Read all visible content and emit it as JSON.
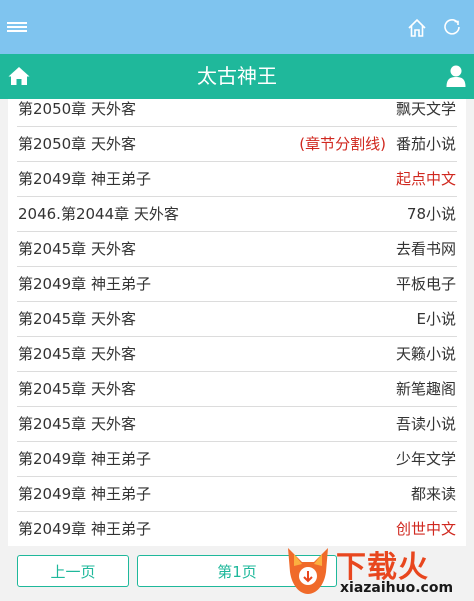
{
  "header": {
    "title": "太古神王"
  },
  "rows": [
    {
      "chapter": "第2050章 天外客",
      "source": "飘天文学",
      "highlight": false,
      "marker": ""
    },
    {
      "chapter": "第2050章 天外客",
      "source": "番茄小说",
      "highlight": false,
      "marker": "(章节分割线)"
    },
    {
      "chapter": "第2049章 神王弟子",
      "source": "起点中文",
      "highlight": true,
      "marker": ""
    },
    {
      "chapter": "2046.第2044章 天外客",
      "source": "78小说",
      "highlight": false,
      "marker": ""
    },
    {
      "chapter": "第2045章 天外客",
      "source": "去看书网",
      "highlight": false,
      "marker": ""
    },
    {
      "chapter": "第2049章 神王弟子",
      "source": "平板电子",
      "highlight": false,
      "marker": ""
    },
    {
      "chapter": "第2045章 天外客",
      "source": "E小说",
      "highlight": false,
      "marker": ""
    },
    {
      "chapter": "第2045章 天外客",
      "source": "天籁小说",
      "highlight": false,
      "marker": ""
    },
    {
      "chapter": "第2045章 天外客",
      "source": "新笔趣阁",
      "highlight": false,
      "marker": ""
    },
    {
      "chapter": "第2045章 天外客",
      "source": "吾读小说",
      "highlight": false,
      "marker": ""
    },
    {
      "chapter": "第2049章 神王弟子",
      "source": "少年文学",
      "highlight": false,
      "marker": ""
    },
    {
      "chapter": "第2049章 神王弟子",
      "source": "都来读",
      "highlight": false,
      "marker": ""
    },
    {
      "chapter": "第2049章 神王弟子",
      "source": "创世中文",
      "highlight": true,
      "marker": ""
    }
  ],
  "pager": {
    "prev_label": "上一页",
    "page_label": "第1页"
  },
  "watermark": {
    "text": "下载火",
    "url": "xiazaihuo.com"
  },
  "colors": {
    "topbar": "#7fc4ef",
    "header": "#1fb89b",
    "highlight": "#d0281f"
  }
}
